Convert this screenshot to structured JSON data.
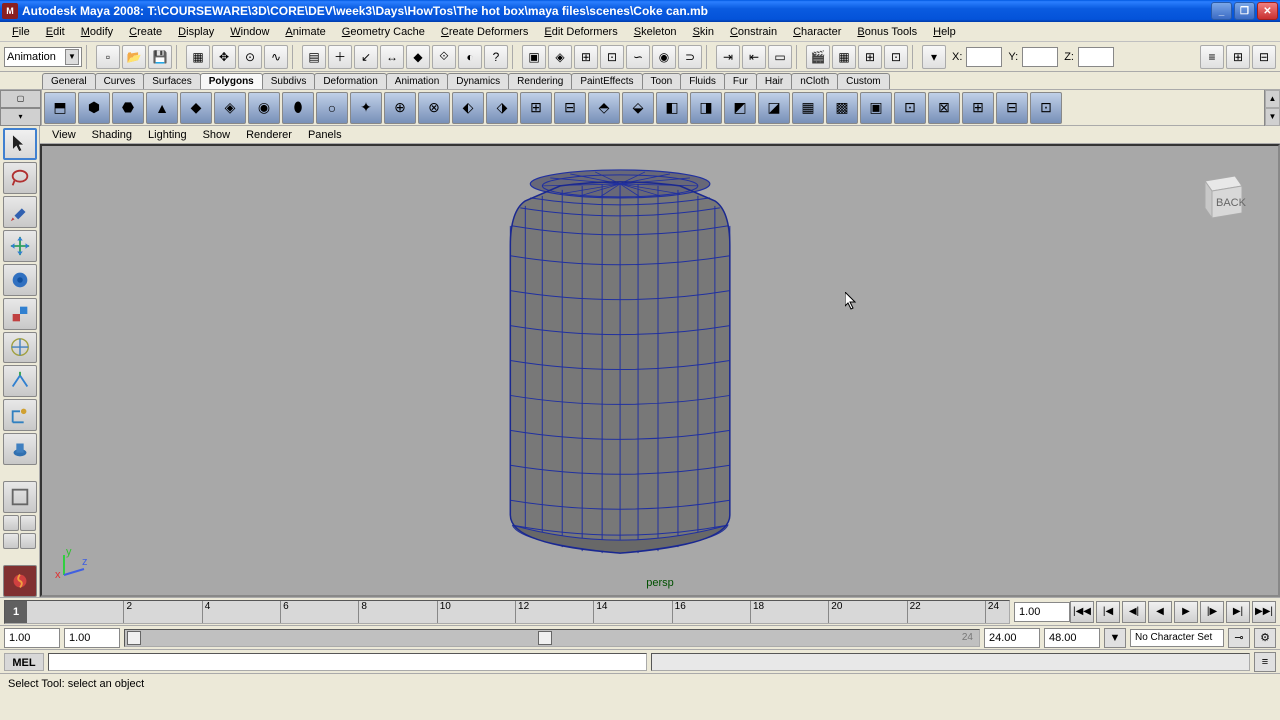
{
  "titlebar": {
    "app_icon_letter": "M",
    "title": "Autodesk Maya 2008: T:\\COURSEWARE\\3D\\CORE\\DEV\\week3\\Days\\HowTos\\The hot box\\maya files\\scenes\\Coke can.mb",
    "min": "_",
    "max": "❐",
    "close": "✕"
  },
  "menus": {
    "items": [
      "File",
      "Edit",
      "Modify",
      "Create",
      "Display",
      "Window",
      "Animate",
      "Geometry Cache",
      "Create Deformers",
      "Edit Deformers",
      "Skeleton",
      "Skin",
      "Constrain",
      "Character",
      "Bonus Tools",
      "Help"
    ]
  },
  "mode_dropdown": "Animation",
  "coords": {
    "x_label": "X:",
    "y_label": "Y:",
    "z_label": "Z:",
    "x": "",
    "y": "",
    "z": ""
  },
  "shelf_tabs": [
    "General",
    "Curves",
    "Surfaces",
    "Polygons",
    "Subdivs",
    "Deformation",
    "Animation",
    "Dynamics",
    "Rendering",
    "PaintEffects",
    "Toon",
    "Fluids",
    "Fur",
    "Hair",
    "nCloth",
    "Custom"
  ],
  "shelf_active": "Polygons",
  "panel_menus": [
    "View",
    "Shading",
    "Lighting",
    "Show",
    "Renderer",
    "Panels"
  ],
  "viewport": {
    "camera_label": "persp",
    "cube_face": "BACK",
    "axis_x": "x",
    "axis_y": "y",
    "axis_z": "z"
  },
  "timeline": {
    "ticks": [
      "2",
      "4",
      "6",
      "8",
      "10",
      "12",
      "14",
      "16",
      "18",
      "20",
      "22",
      "24"
    ],
    "current_frame_marker": "1",
    "current_field": "1.00",
    "range_start": "1.00",
    "range_inner_start": "1.00",
    "range_inner_end_hint": "24",
    "range_end": "24.00",
    "range_outer_end": "48.00",
    "char_set": "No Character Set"
  },
  "cmd": {
    "lang": "MEL"
  },
  "status": {
    "text": "Select Tool: select an object"
  }
}
